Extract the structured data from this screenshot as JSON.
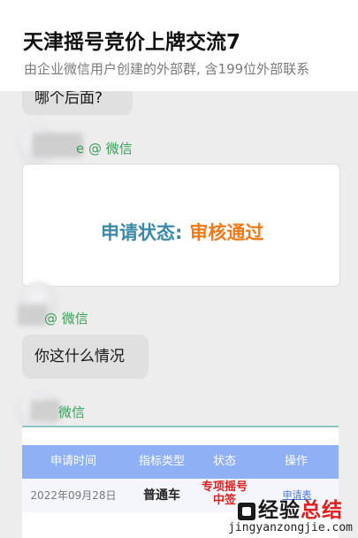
{
  "header": {
    "title": "天津摇号竞价上牌交流7",
    "subtitle": "由企业微信用户创建的外部群, 含199位外部联系"
  },
  "messages": [
    {
      "id": "m1",
      "text": "哪个后面?"
    },
    {
      "id": "m2",
      "sender_suffix": "e @ 微信"
    },
    {
      "id": "m3",
      "sender_suffix": "@ 微信",
      "text": "你这什么情况"
    },
    {
      "id": "m4",
      "sender_suffix": "微信"
    }
  ],
  "status_card": {
    "label": "申请状态:",
    "value": "审核通过"
  },
  "table_card": {
    "columns": [
      "申请时间",
      "指标类型",
      "状态",
      "操作"
    ],
    "row": {
      "date": "2022年09月28日",
      "type": "普通车",
      "status_line1": "专项摇号",
      "status_line2": "中签",
      "action": "申请表"
    }
  },
  "watermark": {
    "cn_part1": "经验",
    "cn_part2": "总结",
    "en": "jingyanzongjie.com"
  },
  "colors": {
    "sender_green": "#3aa05a",
    "status_label": "#3d8aa8",
    "status_value": "#f07a1a",
    "table_header": "#8fb0f5",
    "alert_red": "#e02020"
  }
}
